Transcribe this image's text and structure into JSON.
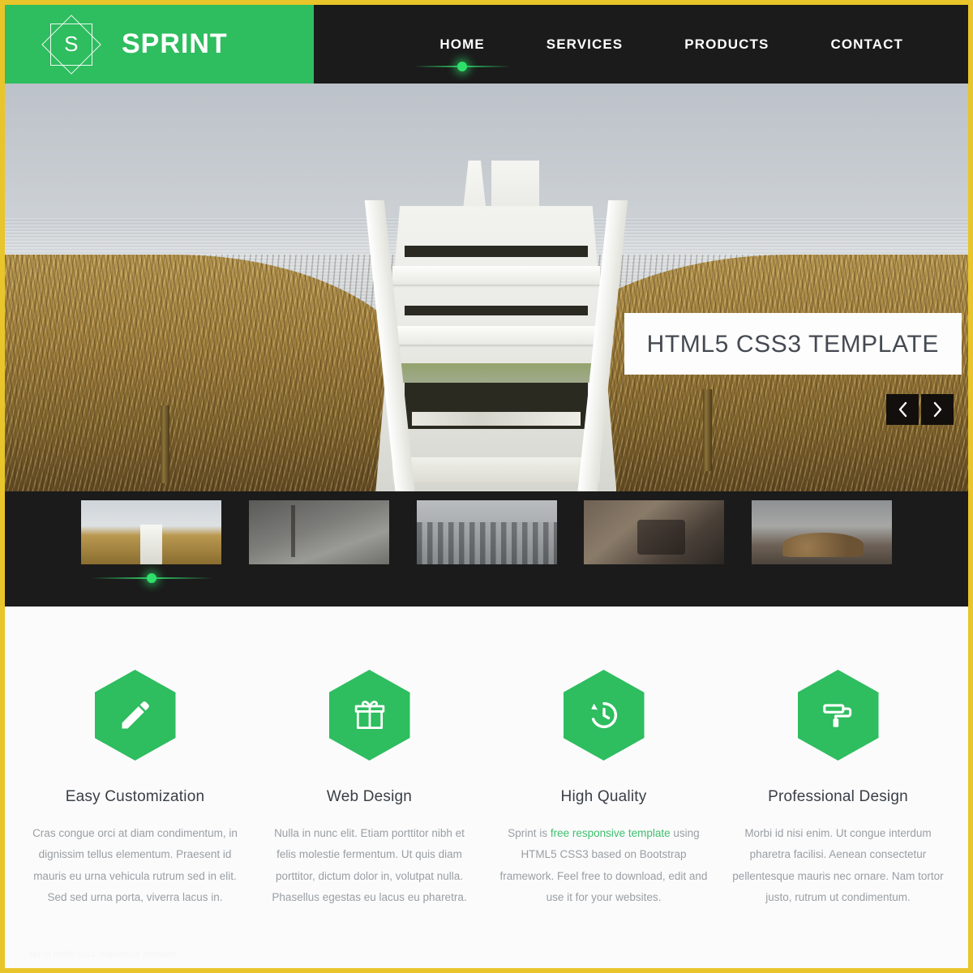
{
  "theme": {
    "accent_green": "#2ebd5f",
    "glow_green": "#2ee06a",
    "dark": "#1b1b1b",
    "frame_yellow": "#e8c52a",
    "link_green": "#3fbf6e"
  },
  "header": {
    "logo_letter": "S",
    "brand_name": "SPRINT",
    "nav": [
      {
        "label": "HOME",
        "active": true
      },
      {
        "label": "SERVICES",
        "active": false
      },
      {
        "label": "PRODUCTS",
        "active": false
      },
      {
        "label": "CONTACT",
        "active": false
      }
    ]
  },
  "hero": {
    "caption": "HTML5 CSS3 TEMPLATE",
    "prev_label": "‹",
    "next_label": "›",
    "image_alt": "white wooden beach stairway between dune grass with ocean behind"
  },
  "thumbnails": [
    {
      "alt": "beach stairway in dune grass",
      "active": true
    },
    {
      "alt": "foggy forest trees",
      "active": false
    },
    {
      "alt": "black and white city skyline",
      "active": false
    },
    {
      "alt": "bicycle parked on a street",
      "active": false
    },
    {
      "alt": "stacked logs in misty forest",
      "active": false
    }
  ],
  "features": [
    {
      "icon": "pencil-icon",
      "title": "Easy Customization",
      "text": "Cras congue orci at diam condimentum, in dignissim tellus elementum. Praesent id mauris eu urna vehicula rutrum sed in elit. Sed sed urna porta, viverra lacus in."
    },
    {
      "icon": "gift-icon",
      "title": "Web Design",
      "text": "Nulla in nunc elit. Etiam porttitor nibh et felis molestie fermentum. Ut quis diam porttitor, dictum dolor in, volutpat nulla. Phasellus egestas eu lacus eu pharetra."
    },
    {
      "icon": "history-clock-icon",
      "title": "High Quality",
      "text_before": "Sprint is ",
      "link_text": "free responsive template",
      "text_after": " using HTML5 CSS3 based on Bootstrap framework. Feel free to download, edit and use it for your websites."
    },
    {
      "icon": "paint-roller-icon",
      "title": "Professional Design",
      "text": "Morbi id nisi enim. Ut congue interdum pharetra facilisi. Aenean consectetur pellentesque mauris nec ornare. Nam tortor justo, rutrum ut condimentum."
    }
  ],
  "footer_note": {
    "text": "sprint html5 css3 responsive template"
  }
}
